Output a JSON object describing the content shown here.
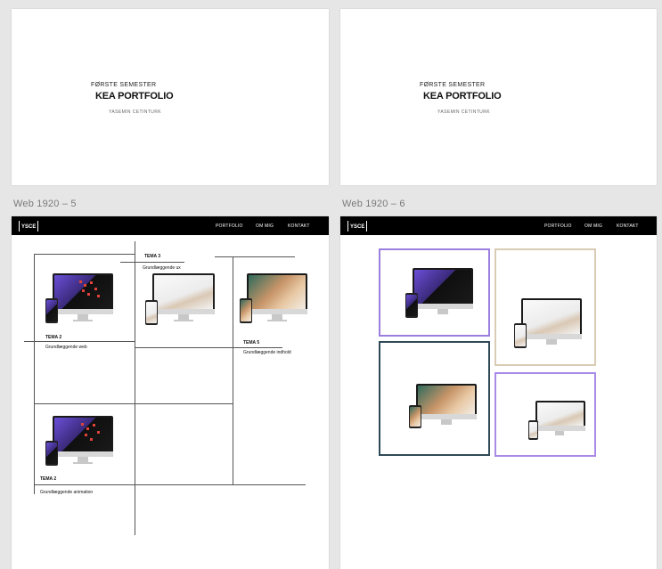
{
  "artboards": {
    "top_left": {
      "subtitle": "FØRSTE SEMESTER",
      "title": "KEA PORTFOLIO",
      "author": "YASEMIN CETINTURK"
    },
    "top_right": {
      "subtitle": "FØRSTE SEMESTER",
      "title": "KEA PORTFOLIO",
      "author": "YASEMIN CETINTURK"
    },
    "web5": {
      "label": "Web 1920 – 5",
      "nav": {
        "logo": "YSCE",
        "items": [
          "PORTFOLIO",
          "OM MIG",
          "KONTAKT"
        ]
      },
      "temas": [
        {
          "title": "TEMA 3",
          "subtitle": "Grundlæggende ux"
        },
        {
          "title": "TEMA 2",
          "subtitle": "Grundlæggende web"
        },
        {
          "title": "TEMA 5",
          "subtitle": "Grundlæggende indhold"
        },
        {
          "title": "TEMA 2",
          "subtitle": "Grundlæggende animation"
        }
      ]
    },
    "web6": {
      "label": "Web 1920 – 6",
      "nav": {
        "logo": "YSCE",
        "items": [
          "PORTFOLIO",
          "OM MIG",
          "KONTAKT"
        ]
      },
      "frame_colors": [
        "#9b7fe0",
        "#d9cbb4",
        "#2f4a57",
        "#a98ae6"
      ]
    }
  }
}
